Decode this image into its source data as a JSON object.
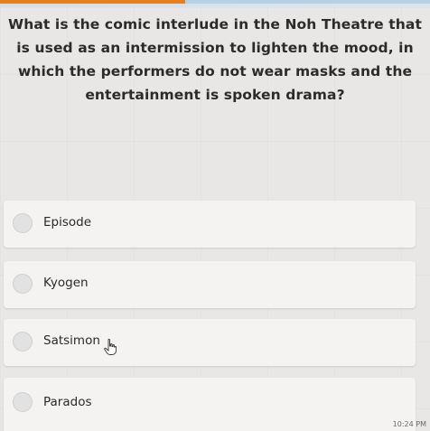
{
  "progress": {
    "fraction": 0.43,
    "color": "#e67e22"
  },
  "question": {
    "lines": [
      "What is the comic interlude in the Noh Theatre that",
      "is used as an intermission to lighten the mood, in",
      "which the performers do not wear masks and the",
      "entertainment is spoken drama?"
    ]
  },
  "options": [
    {
      "label": "Episode"
    },
    {
      "label": "Kyogen"
    },
    {
      "label": "Satsimon"
    },
    {
      "label": "Parados"
    }
  ],
  "cursor": {
    "icon": "hand-pointer-icon"
  },
  "clock": {
    "time": "10:24 PM"
  }
}
